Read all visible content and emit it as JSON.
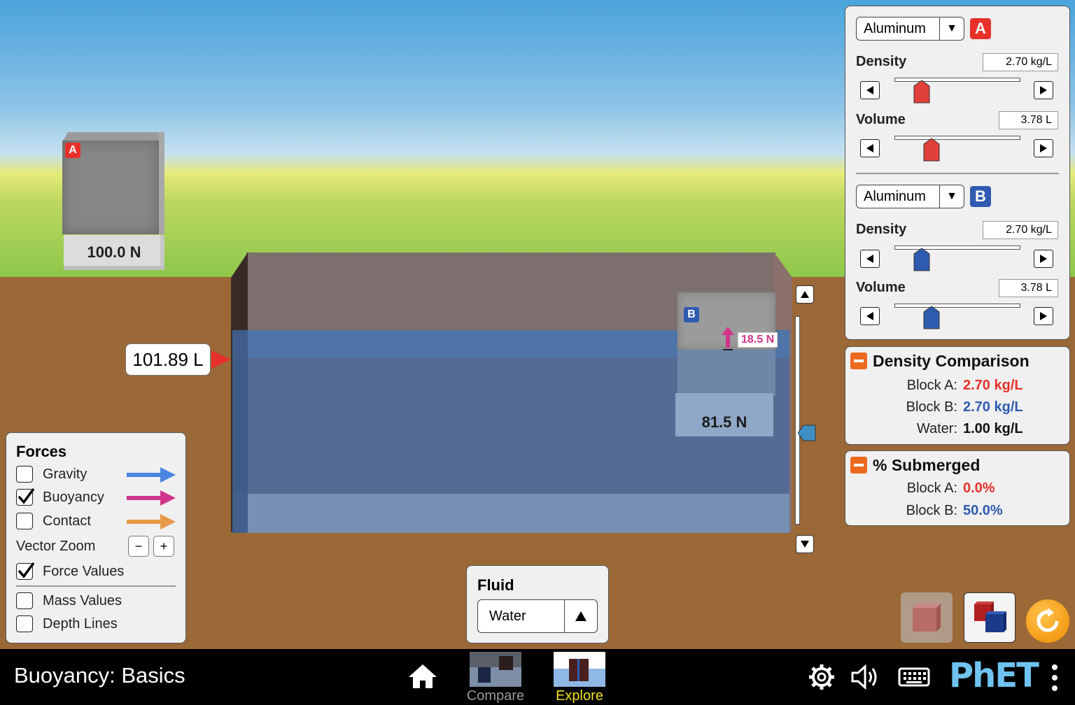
{
  "app": {
    "title": "Buoyancy: Basics"
  },
  "scene": {
    "block_a": {
      "badge": "A",
      "scale_reading": "100.0 N"
    },
    "block_b": {
      "badge": "B",
      "scale_reading": "81.5 N",
      "buoyancy_force": "18.5 N"
    },
    "pool_volume": "101.89 L"
  },
  "material_panel": {
    "block_a": {
      "material": "Aluminum",
      "badge": "A",
      "density_label": "Density",
      "density_value": "2.70 kg/L",
      "density_fraction": 0.22,
      "volume_label": "Volume",
      "volume_value": "3.78 L",
      "volume_fraction": 0.3
    },
    "block_b": {
      "material": "Aluminum",
      "badge": "B",
      "density_label": "Density",
      "density_value": "2.70 kg/L",
      "density_fraction": 0.22,
      "volume_label": "Volume",
      "volume_value": "3.78 L",
      "volume_fraction": 0.3
    }
  },
  "density_comparison": {
    "title": "Density Comparison",
    "rows": [
      {
        "label": "Block A:",
        "value": "2.70 kg/L",
        "color": "#e8302a"
      },
      {
        "label": "Block B:",
        "value": "2.70 kg/L",
        "color": "#2f5bb0"
      },
      {
        "label": "Water:",
        "value": "1.00 kg/L",
        "color": "#111111"
      }
    ]
  },
  "percent_submerged": {
    "title": "% Submerged",
    "rows": [
      {
        "label": "Block A:",
        "value": "0.0%",
        "color": "#e8302a"
      },
      {
        "label": "Block B:",
        "value": "50.0%",
        "color": "#2f5bb0"
      }
    ]
  },
  "forces_panel": {
    "title": "Forces",
    "gravity": {
      "label": "Gravity",
      "checked": false,
      "color": "#4a86e0"
    },
    "buoyancy": {
      "label": "Buoyancy",
      "checked": true,
      "color": "#d0348b"
    },
    "contact": {
      "label": "Contact",
      "checked": false,
      "color": "#e89a48"
    },
    "vector_zoom": {
      "label": "Vector Zoom",
      "minus": "−",
      "plus": "+"
    },
    "force_values": {
      "label": "Force Values",
      "checked": true
    },
    "mass_values": {
      "label": "Mass Values",
      "checked": false
    },
    "depth_lines": {
      "label": "Depth Lines",
      "checked": false
    }
  },
  "fluid_panel": {
    "title": "Fluid",
    "selected": "Water"
  },
  "nav": {
    "screens": [
      {
        "label": "Compare",
        "active": false
      },
      {
        "label": "Explore",
        "active": true
      }
    ],
    "brand": "PhET"
  },
  "colors": {
    "block_a": "#e8302a",
    "block_b": "#2f5bb0",
    "active_screen": "#f4e01f",
    "inactive_screen": "#9a9a9a"
  }
}
